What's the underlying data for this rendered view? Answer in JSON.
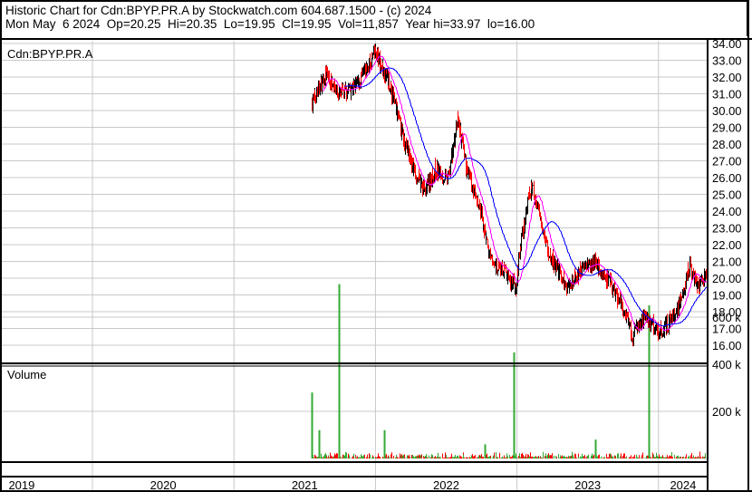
{
  "header": {
    "title": "Historic Chart for Cdn:BPYP.PR.A by Stockwatch.com 604.687.1500 - (c) 2024",
    "quote": "Mon May  6 2024  Op=20.25  Hi=20.35  Lo=19.95  Cl=19.95  Vol=11,857  Year hi=33.97  lo=16.00"
  },
  "chart_data": [
    {
      "type": "line",
      "title": "Cdn:BPYP.PR.A",
      "ylim": [
        16,
        34
      ],
      "yticks": [
        "16.00",
        "17.00",
        "18.00",
        "19.00",
        "20.00",
        "21.00",
        "22.00",
        "23.00",
        "24.00",
        "25.00",
        "26.00",
        "27.00",
        "28.00",
        "29.00",
        "30.00",
        "31.00",
        "32.00",
        "33.00",
        "34.00"
      ],
      "xlim": [
        2019.0,
        2024.35
      ],
      "xticks": [
        "2019",
        "2020",
        "2021",
        "2022",
        "2023",
        "2024"
      ],
      "colors": {
        "up": "#000000",
        "down": "#ff0000",
        "ma_short": "#ff00ff",
        "ma_long": "#0000ff"
      },
      "series": [
        {
          "name": "close",
          "points": [
            [
              2021.55,
              30.5
            ],
            [
              2021.65,
              32.2
            ],
            [
              2021.74,
              31.0
            ],
            [
              2021.87,
              31.5
            ],
            [
              2022.0,
              33.5
            ],
            [
              2022.1,
              31.5
            ],
            [
              2022.19,
              28.5
            ],
            [
              2022.29,
              26.0
            ],
            [
              2022.35,
              25.2
            ],
            [
              2022.42,
              26.5
            ],
            [
              2022.51,
              25.8
            ],
            [
              2022.58,
              29.5
            ],
            [
              2022.64,
              26.5
            ],
            [
              2022.74,
              24.0
            ],
            [
              2022.81,
              21.0
            ],
            [
              2022.9,
              20.5
            ],
            [
              2022.99,
              19.5
            ],
            [
              2023.03,
              22.5
            ],
            [
              2023.1,
              25.5
            ],
            [
              2023.17,
              23.5
            ],
            [
              2023.22,
              21.5
            ],
            [
              2023.35,
              19.5
            ],
            [
              2023.45,
              20.5
            ],
            [
              2023.54,
              21.0
            ],
            [
              2023.63,
              20.0
            ],
            [
              2023.73,
              18.5
            ],
            [
              2023.81,
              16.5
            ],
            [
              2023.9,
              17.8
            ],
            [
              2024.0,
              16.8
            ],
            [
              2024.12,
              17.8
            ],
            [
              2024.22,
              20.8
            ],
            [
              2024.28,
              19.5
            ],
            [
              2024.34,
              20.0
            ]
          ]
        }
      ]
    },
    {
      "type": "bar",
      "title": "Volume",
      "ylim": [
        0,
        700000
      ],
      "yticks": [
        "200 k",
        "400 k",
        "600 k"
      ],
      "spikes": [
        [
          2021.55,
          280000
        ],
        [
          2021.6,
          120000
        ],
        [
          2021.74,
          740000
        ],
        [
          2022.06,
          120000
        ],
        [
          2022.77,
          60000
        ],
        [
          2022.98,
          450000
        ],
        [
          2023.93,
          650000
        ],
        [
          2023.55,
          80000
        ]
      ]
    }
  ]
}
